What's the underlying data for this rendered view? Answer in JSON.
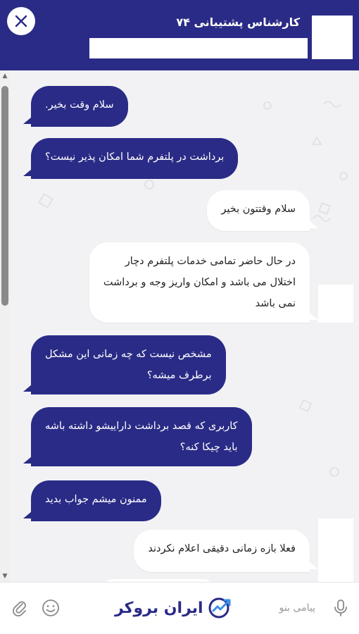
{
  "header": {
    "title": "کارشناس پشتیبانی ۷۴"
  },
  "messages": [
    {
      "from": "user",
      "lines": [
        "سلام وقت بخیر."
      ]
    },
    {
      "from": "user",
      "lines": [
        "برداشت در پلتفرم شما امکان پذیر نیست؟"
      ]
    },
    {
      "from": "agent",
      "lines": [
        "سلام وقتتون بخیر"
      ]
    },
    {
      "from": "agent",
      "lines": [
        "در حال حاضر تمامی خدمات  پلتفرم دچار",
        "اختلال می باشد و امکان  واریز  وجه و برداشت",
        "نمی باشد"
      ]
    },
    {
      "from": "user",
      "lines": [
        "مشخص نیست که چه زمانی این مشکل",
        "برطرف میشه؟"
      ]
    },
    {
      "from": "user",
      "lines": [
        "کاربری که قصد برداشت داراییشو داشته باشه",
        "باید چیکا کنه؟"
      ]
    },
    {
      "from": "user",
      "lines": [
        "ممنون میشم جواب بدید"
      ]
    },
    {
      "from": "agent",
      "lines": [
        "فعلا بازه زمانی دقیقی اعلام نکردند"
      ]
    }
  ],
  "footer": {
    "brand": "ایران بروکر",
    "input_placeholder": "پیامی بنو"
  },
  "colors": {
    "primary": "#2a2b86",
    "background": "#f2f2f4",
    "agent_bubble": "#ffffff"
  }
}
